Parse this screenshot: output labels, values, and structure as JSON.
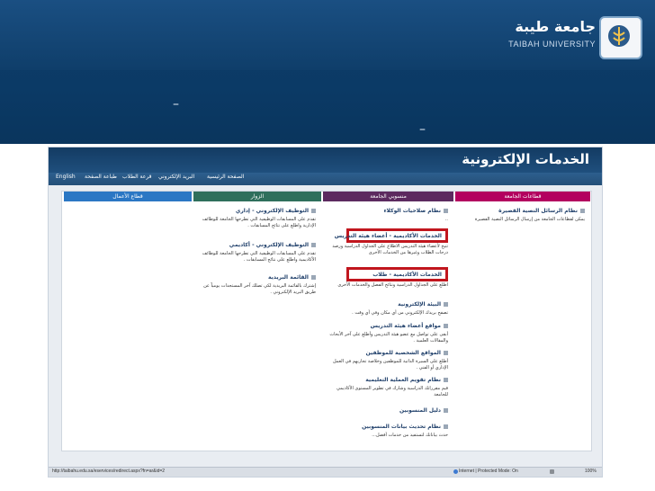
{
  "slide": {
    "dash_a": "–",
    "dash_b": "–",
    "logo_ar": "جامعة طيبة",
    "logo_en": "TAIBAH UNIVERSITY"
  },
  "portal": {
    "title": "الخدمات الإلكترونية",
    "nav": {
      "english": "English",
      "print_page": "طباعة الصفحة",
      "schedule": "قرعة الطلاب",
      "email": "البريد الإلكتروني",
      "home": "الصفحة الرئيسية"
    }
  },
  "columns": {
    "univ_sectors": {
      "header": "قطاعات الجامعة",
      "color": "#b3005f",
      "items": [
        {
          "title": "نظام الرسائل النصية القصيرة",
          "desc": "يمكن لقطاعات الجامعة من إرسال الرسائل النصية القصيرة"
        }
      ]
    },
    "univ_staff": {
      "header": "منسوبي الجامعة",
      "color": "#5c2a5f",
      "items": [
        {
          "title": "نظام صلاحيات الوكلاء",
          "desc": ".."
        },
        {
          "title": "الخدمات الأكاديمية - أعضاء هيئة التدريس",
          "desc": "تتيح لأعضاء هيئة التدريس الاطلاع على الجداول الدراسية ورصد درجات الطلاب وغيرها من الخدمات الأخرى"
        },
        {
          "title": "الخدمات الأكاديمية - طلاب",
          "desc": "اطلع على الجداول الدراسية ونتائج الفصل والخدمات الأخرى"
        },
        {
          "title": "البيئة الإلكترونية",
          "desc": "تصفح بريدك الإلكتروني من أي مكان وفي أي وقت ."
        },
        {
          "title": "مواقع أعضاء هيئة التدريس",
          "desc": "أبقى على تواصل مع عضو هيئة التدريس وأطلع على آخر الأبحاث والمقالات العلمية ."
        },
        {
          "title": "المواقع الشخصية للموظفين",
          "desc": "أطلع على السيرة الذاتية للموظفين وخلاصة تجاربهم في العمل الإداري أو الفني ."
        },
        {
          "title": "نظام تقويم العملية التعليمية",
          "desc": "قيم مقرراتك الدراسية وشارك في تطوير المستوى الأكاديمي للجامعة"
        },
        {
          "title": "دليل المنسوبين",
          "desc": ""
        },
        {
          "title": "نظام تحديث بيانات المنسوبين",
          "desc": "حدث بياناتك لتستفيد من خدمات أفضل..."
        }
      ]
    },
    "visitors": {
      "header": "الزوار",
      "color": "#2f6f5c",
      "items": [
        {
          "title": "التوظيف الإلكتروني - إداري",
          "desc": "تقدم على المسابقات الوظيفية التي تطرحها الجامعة للوظائف الإدارية واطلع على نتائج المسابقات ."
        },
        {
          "title": "التوظيف الإلكتروني - أكاديمي",
          "desc": "تقدم على المسابقات الوظيفية التي تطرحها الجامعة للوظائف الأكاديمية واطلع على نتائج المسابقات ."
        },
        {
          "title": "القائمة البريدية",
          "desc": "إشترك بالقائمة البريدية لكي تصلك آخر المستجدات يومياً عن طريق البريد الإلكتروني ."
        }
      ]
    },
    "business": {
      "header": "قطاع الأعمال",
      "color": "#2b77c4",
      "items": []
    }
  },
  "status": {
    "url": "http://taibahu.edu.sa/eservices/redirect.aspx?fn=ar&id=2",
    "mode": "Internet | Protected Mode: On",
    "zoom": "100%"
  }
}
